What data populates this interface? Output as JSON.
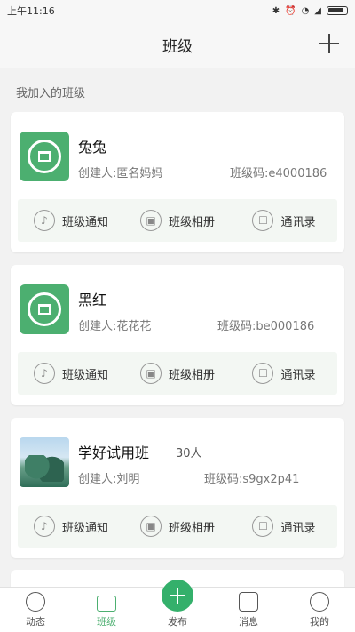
{
  "status_bar": {
    "time": "上午11:16",
    "icons": [
      "bluetooth-icon",
      "alarm-icon",
      "wifi-icon",
      "signal-icon",
      "battery-icon"
    ]
  },
  "header": {
    "title": "班级",
    "add_icon": "plus-icon"
  },
  "section": {
    "label": "我加入的班级"
  },
  "classes": [
    {
      "name": "兔兔",
      "member_count": "",
      "creator": "创建人:匿名妈妈",
      "code": "班级码:e4000186",
      "avatar": "book-logo-icon",
      "actions": [
        {
          "label": "班级通知",
          "icon": "bell-icon"
        },
        {
          "label": "班级相册",
          "icon": "photo-icon"
        },
        {
          "label": "通讯录",
          "icon": "contacts-icon"
        }
      ]
    },
    {
      "name": "黑红",
      "member_count": "",
      "creator": "创建人:花花花",
      "code": "班级码:be000186",
      "avatar": "book-logo-icon",
      "actions": [
        {
          "label": "班级通知",
          "icon": "bell-icon"
        },
        {
          "label": "班级相册",
          "icon": "photo-icon"
        },
        {
          "label": "通讯录",
          "icon": "contacts-icon"
        }
      ]
    },
    {
      "name": "学好试用班",
      "member_count": "30人",
      "creator": "创建人:刘明",
      "code": "班级码:s9gx2p41",
      "avatar": "class-photo",
      "actions": [
        {
          "label": "班级通知",
          "icon": "bell-icon"
        },
        {
          "label": "班级相册",
          "icon": "photo-icon"
        },
        {
          "label": "通讯录",
          "icon": "contacts-icon"
        }
      ]
    }
  ],
  "tab_bar": {
    "tabs": [
      {
        "label": "动态",
        "icon": "activity-icon"
      },
      {
        "label": "班级",
        "icon": "class-icon",
        "active": true
      },
      {
        "label": "发布",
        "icon": "publish-plus-icon"
      },
      {
        "label": "消息",
        "icon": "message-icon"
      },
      {
        "label": "我的",
        "icon": "profile-icon"
      }
    ]
  },
  "colors": {
    "accent": "#34b06b",
    "logo_green": "#4caf70",
    "action_bg": "#f3f7f3"
  }
}
